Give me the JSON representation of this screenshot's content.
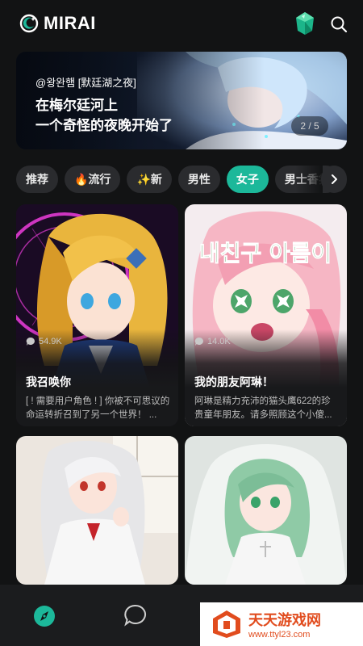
{
  "header": {
    "app_name": "MIRAI",
    "icons": [
      "moon-logo-icon",
      "gem-icon",
      "search-icon"
    ],
    "accent": "#1cb89a"
  },
  "banner": {
    "author": "@왕완햄 [默廷湖之夜]",
    "line1": "在梅尔廷河上",
    "line2": "一个奇怪的夜晚开始了",
    "page": "2 / 5"
  },
  "chips": [
    {
      "label": "推荐",
      "active": false
    },
    {
      "label": "🔥流行",
      "active": false
    },
    {
      "label": "✨新",
      "active": false
    },
    {
      "label": "男性",
      "active": false
    },
    {
      "label": "女子",
      "active": true
    },
    {
      "label": "男士香氛",
      "active": false
    }
  ],
  "cards": [
    {
      "stat": "54.9K",
      "title": "我召唤你",
      "desc": "[ ! 需要用户角色 ! ] 你被不可思议的命运转折召到了另一个世界！ ..."
    },
    {
      "stat": "14.0K",
      "title": "我的朋友阿琳！",
      "desc": "阿琳是精力充沛的猫头鹰622的珍贵童年朋友。请多照顾这个小傻..."
    },
    {
      "stat": "",
      "title": "",
      "desc": ""
    },
    {
      "stat": "",
      "title": "",
      "desc": ""
    }
  ],
  "card2_overlay_text": "내친구 아름이",
  "nav": {
    "items": [
      "compass-icon",
      "chat-bubble-icon"
    ]
  },
  "watermark": {
    "title": "天天游戏网",
    "url": "www.ttyl23.com"
  }
}
